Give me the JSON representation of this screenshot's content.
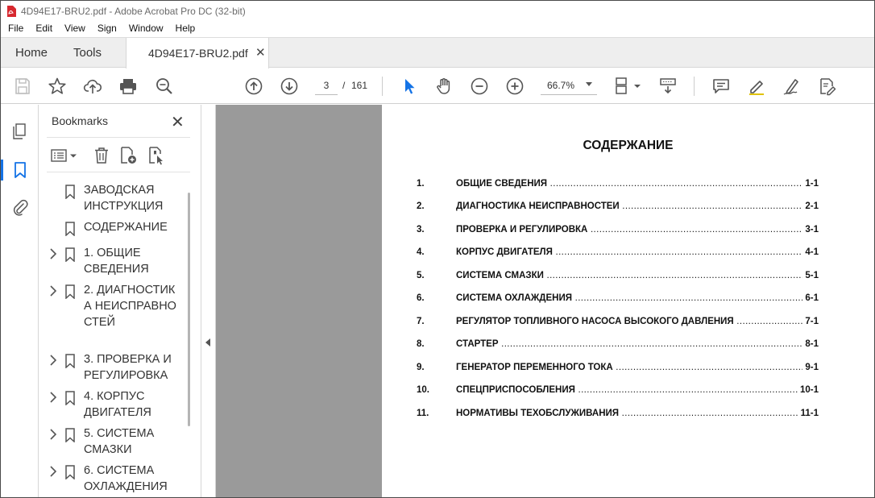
{
  "window": {
    "title": "4D94E17-BRU2.pdf - Adobe Acrobat Pro DC (32-bit)"
  },
  "menu": [
    "File",
    "Edit",
    "View",
    "Sign",
    "Window",
    "Help"
  ],
  "tabs": {
    "home": "Home",
    "tools": "Tools",
    "document": "4D94E17-BRU2.pdf",
    "close": "✕"
  },
  "toolbar": {
    "current_page": "3",
    "separator": "/",
    "total_pages": "161",
    "zoom": "66.7%"
  },
  "bookmarks": {
    "title": "Bookmarks",
    "close": "✕",
    "items": [
      {
        "label": "ЗАВОДСКАЯ ИНСТРУКЦИЯ",
        "expandable": false
      },
      {
        "label": "СОДЕРЖАНИЕ",
        "expandable": false
      },
      {
        "label": "1. ОБЩИЕ СВЕДЕНИЯ",
        "expandable": true
      },
      {
        "label": "2. ДИАГНОСТИКА НЕИСПРАВНОСТЕЙ",
        "expandable": true
      },
      {
        "label": "3. ПРОВЕРКА И РЕГУЛИРОВКА",
        "expandable": true
      },
      {
        "label": "4. КОРПУС ДВИГАТЕЛЯ",
        "expandable": true
      },
      {
        "label": "5. СИСТЕМА СМАЗКИ",
        "expandable": true
      },
      {
        "label": "6. СИСТЕМА ОХЛАЖДЕНИЯ",
        "expandable": true
      }
    ]
  },
  "document": {
    "heading": "СОДЕРЖАНИЕ",
    "toc": [
      {
        "num": "1.",
        "text": "ОБЩИЕ СВЕДЕНИЯ",
        "page": "1-1"
      },
      {
        "num": "2.",
        "text": "ДИАГНОСТИКА НЕИСПРАВНОСТЕЙ",
        "page": "2-1"
      },
      {
        "num": "3.",
        "text": "ПРОВЕРКА И РЕГУЛИРОВКА",
        "page": "3-1"
      },
      {
        "num": "4.",
        "text": "КОРПУС ДВИГАТЕЛЯ",
        "page": "4-1"
      },
      {
        "num": "5.",
        "text": "СИСТЕМА СМАЗКИ",
        "page": "5-1"
      },
      {
        "num": "6.",
        "text": "СИСТЕМА ОХЛАЖДЕНИЯ",
        "page": "6-1"
      },
      {
        "num": "7.",
        "text": "РЕГУЛЯТОР ТОПЛИВНОГО НАСОСА ВЫСОКОГО ДАВЛЕНИЯ",
        "page": "7-1"
      },
      {
        "num": "8.",
        "text": "СТАРТЕР",
        "page": "8-1"
      },
      {
        "num": "9.",
        "text": "ГЕНЕРАТОР ПЕРЕМЕННОГО ТОКА",
        "page": "9-1"
      },
      {
        "num": "10.",
        "text": "СПЕЦПРИСПОСОБЛЕНИЯ",
        "page": "10-1"
      },
      {
        "num": "11.",
        "text": "НОРМАТИВЫ ТЕХОБСЛУЖИВАНИЯ",
        "page": "11-1"
      }
    ]
  },
  "colors": {
    "accent": "#1473e6",
    "pdf_red": "#d7282f",
    "canvas_gray": "#9a9a9a"
  }
}
